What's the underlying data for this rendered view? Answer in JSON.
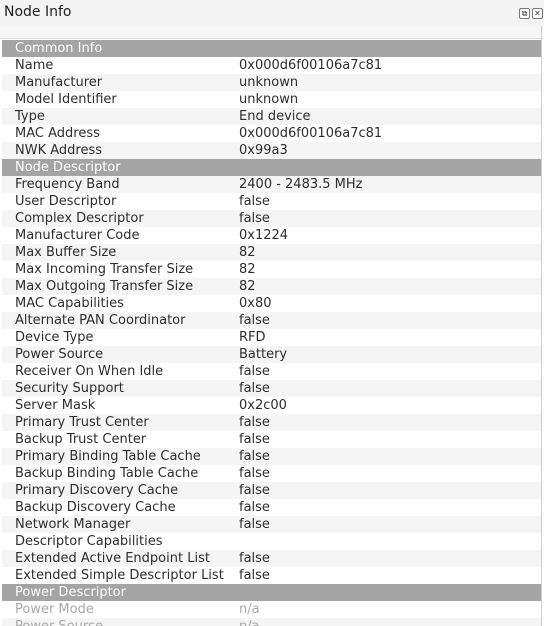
{
  "window": {
    "title": "Node Info",
    "float_glyph": "⧉",
    "close_glyph": "✕"
  },
  "sections": [
    {
      "title": "Common Info",
      "rows": [
        {
          "key": "Name",
          "value": "0x000d6f00106a7c81"
        },
        {
          "key": "Manufacturer",
          "value": "unknown"
        },
        {
          "key": "Model Identifier",
          "value": "unknown"
        },
        {
          "key": "Type",
          "value": "End device"
        },
        {
          "key": "MAC Address",
          "value": "0x000d6f00106a7c81"
        },
        {
          "key": "NWK Address",
          "value": "0x99a3"
        }
      ]
    },
    {
      "title": "Node Descriptor",
      "rows": [
        {
          "key": "Frequency Band",
          "value": "2400 - 2483.5 MHz"
        },
        {
          "key": "User Descriptor",
          "value": "false"
        },
        {
          "key": "Complex Descriptor",
          "value": "false"
        },
        {
          "key": "Manufacturer Code",
          "value": "0x1224"
        },
        {
          "key": "Max Buffer Size",
          "value": "82"
        },
        {
          "key": "Max Incoming Transfer Size",
          "value": "82"
        },
        {
          "key": "Max Outgoing Transfer Size",
          "value": "82"
        },
        {
          "key": "MAC Capabilities",
          "value": "0x80"
        },
        {
          "key": "Alternate PAN Coordinator",
          "value": "false"
        },
        {
          "key": "Device Type",
          "value": "RFD"
        },
        {
          "key": "Power Source",
          "value": "Battery"
        },
        {
          "key": "Receiver On When Idle",
          "value": "false"
        },
        {
          "key": "Security Support",
          "value": "false"
        },
        {
          "key": "Server Mask",
          "value": "0x2c00"
        },
        {
          "key": "Primary Trust Center",
          "value": "false"
        },
        {
          "key": "Backup Trust Center",
          "value": "false"
        },
        {
          "key": "Primary Binding Table Cache",
          "value": "false"
        },
        {
          "key": "Backup Binding Table Cache",
          "value": "false"
        },
        {
          "key": "Primary Discovery Cache",
          "value": "false"
        },
        {
          "key": "Backup Discovery Cache",
          "value": "false"
        },
        {
          "key": "Network Manager",
          "value": "false"
        },
        {
          "key": "Descriptor Capabilities",
          "value": ""
        },
        {
          "key": "Extended Active Endpoint List",
          "value": "false"
        },
        {
          "key": "Extended Simple Descriptor List",
          "value": "false"
        }
      ]
    },
    {
      "title": "Power Descriptor",
      "disabled": true,
      "rows": [
        {
          "key": "Power Mode",
          "value": "n/a"
        },
        {
          "key": "Power Source",
          "value": "n/a"
        }
      ]
    }
  ]
}
